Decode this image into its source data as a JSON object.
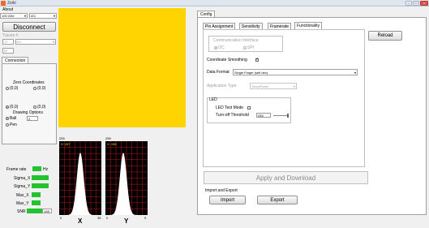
{
  "window": {
    "title": "Zeiki",
    "min_label": "–",
    "max_label": "□",
    "close_label": "x"
  },
  "left": {
    "about_label": "About",
    "interface_combo": "100 22bl",
    "interface_type": "I2C",
    "disconnect_label": "Disconnect",
    "traces_label": "Traces #",
    "traces_x": "17",
    "traces_y": "8V",
    "traces_third": "0F",
    "connection_tab": "Connection",
    "zero_coords_label": "Zero Coordinates",
    "zero_opt1": "(0,0)",
    "zero_opt2": "(0,0)",
    "origin_opt1": "(0,0)",
    "origin_opt2": "(0,0)",
    "drawing_options_label": "Drawing Options",
    "ball_label": "Ball",
    "ball_size": "2",
    "pen_label": "Pen"
  },
  "stats": {
    "frame_rate_label": "Frame rate",
    "frame_rate_value": "",
    "frame_rate_unit": "Hz",
    "sigma_x_label": "Sigma_X",
    "sigma_y_label": "Sigma_Y",
    "max_x_label": "Max_X",
    "max_y_label": "Max_Y",
    "snr_label": "SNR",
    "snr_value": "108"
  },
  "hist_x": {
    "top_label": "255",
    "inner_label": "X: 207",
    "x_min": "0",
    "x_max": "35",
    "axis_label": "X"
  },
  "hist_y": {
    "top_label": "255",
    "inner_label": "X: 158",
    "x_min": "0",
    "x_max": "9",
    "axis_label": "Y"
  },
  "config": {
    "tab_label": "Config",
    "subtabs": [
      "Pin Assignment",
      "Sensitivity",
      "Framerate",
      "Functionality"
    ],
    "active_subtab": "Functionality",
    "reload_label": "Reload",
    "comm_interface_label": "Communication Interface",
    "comm_i2c": "I2C",
    "comm_spi": "SPI",
    "coord_smoothing_label": "Coordinate Smoothing",
    "data_format_label": "Data Format",
    "data_format_value": "Single Finger (self dev)",
    "app_type_label": "Application Type",
    "app_type_value": "TouchPanel",
    "led_label": "LED",
    "led_test_mode_label": "LED Test Mode",
    "turnoff_threshold_label": "Turn-off Threshold",
    "turnoff_threshold_value": "255",
    "apply_label": "Apply and Download",
    "import_export_label": "Import and Export",
    "import_label": "Import",
    "export_label": "Export"
  },
  "colors": {
    "canvas": "#ffd400",
    "stat_green": "#22c32e",
    "hist_grid": "#c01818"
  }
}
